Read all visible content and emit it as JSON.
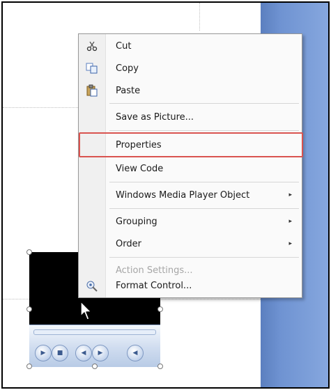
{
  "context_menu": {
    "items": [
      {
        "label": "Cut",
        "icon": "scissors-icon",
        "enabled": true
      },
      {
        "label": "Copy",
        "icon": "copy-icon",
        "enabled": true
      },
      {
        "label": "Paste",
        "icon": "paste-icon",
        "enabled": true
      },
      {
        "label": "Save as Picture...",
        "enabled": true
      },
      {
        "label": "Properties",
        "enabled": true,
        "highlighted": true
      },
      {
        "label": "View Code",
        "enabled": true
      },
      {
        "label": "Windows Media Player Object",
        "submenu": true,
        "enabled": true
      },
      {
        "label": "Grouping",
        "submenu": true,
        "enabled": true
      },
      {
        "label": "Order",
        "submenu": true,
        "enabled": true
      },
      {
        "label": "Action Settings...",
        "enabled": false
      },
      {
        "label": "Format Control...",
        "icon": "format-control-icon",
        "enabled": true
      }
    ],
    "submenu_arrow": "▸",
    "highlight_color": "#d9534f"
  },
  "colors": {
    "slide_side_panel": "#6f93d2",
    "player_video": "#000000",
    "player_controls": "#cfdcef"
  }
}
